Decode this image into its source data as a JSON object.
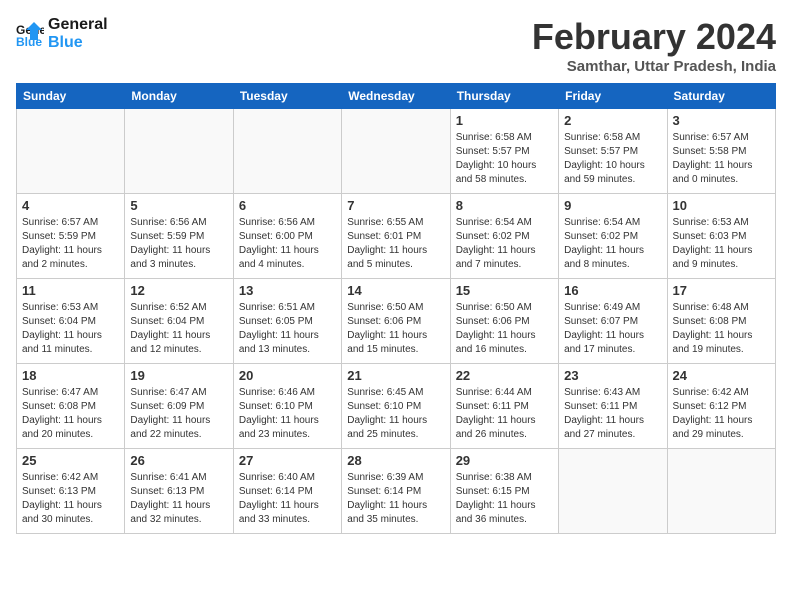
{
  "header": {
    "logo_line1": "General",
    "logo_line2": "Blue",
    "title": "February 2024",
    "subtitle": "Samthar, Uttar Pradesh, India"
  },
  "weekdays": [
    "Sunday",
    "Monday",
    "Tuesday",
    "Wednesday",
    "Thursday",
    "Friday",
    "Saturday"
  ],
  "weeks": [
    [
      {
        "num": "",
        "info": ""
      },
      {
        "num": "",
        "info": ""
      },
      {
        "num": "",
        "info": ""
      },
      {
        "num": "",
        "info": ""
      },
      {
        "num": "1",
        "info": "Sunrise: 6:58 AM\nSunset: 5:57 PM\nDaylight: 10 hours\nand 58 minutes."
      },
      {
        "num": "2",
        "info": "Sunrise: 6:58 AM\nSunset: 5:57 PM\nDaylight: 10 hours\nand 59 minutes."
      },
      {
        "num": "3",
        "info": "Sunrise: 6:57 AM\nSunset: 5:58 PM\nDaylight: 11 hours\nand 0 minutes."
      }
    ],
    [
      {
        "num": "4",
        "info": "Sunrise: 6:57 AM\nSunset: 5:59 PM\nDaylight: 11 hours\nand 2 minutes."
      },
      {
        "num": "5",
        "info": "Sunrise: 6:56 AM\nSunset: 5:59 PM\nDaylight: 11 hours\nand 3 minutes."
      },
      {
        "num": "6",
        "info": "Sunrise: 6:56 AM\nSunset: 6:00 PM\nDaylight: 11 hours\nand 4 minutes."
      },
      {
        "num": "7",
        "info": "Sunrise: 6:55 AM\nSunset: 6:01 PM\nDaylight: 11 hours\nand 5 minutes."
      },
      {
        "num": "8",
        "info": "Sunrise: 6:54 AM\nSunset: 6:02 PM\nDaylight: 11 hours\nand 7 minutes."
      },
      {
        "num": "9",
        "info": "Sunrise: 6:54 AM\nSunset: 6:02 PM\nDaylight: 11 hours\nand 8 minutes."
      },
      {
        "num": "10",
        "info": "Sunrise: 6:53 AM\nSunset: 6:03 PM\nDaylight: 11 hours\nand 9 minutes."
      }
    ],
    [
      {
        "num": "11",
        "info": "Sunrise: 6:53 AM\nSunset: 6:04 PM\nDaylight: 11 hours\nand 11 minutes."
      },
      {
        "num": "12",
        "info": "Sunrise: 6:52 AM\nSunset: 6:04 PM\nDaylight: 11 hours\nand 12 minutes."
      },
      {
        "num": "13",
        "info": "Sunrise: 6:51 AM\nSunset: 6:05 PM\nDaylight: 11 hours\nand 13 minutes."
      },
      {
        "num": "14",
        "info": "Sunrise: 6:50 AM\nSunset: 6:06 PM\nDaylight: 11 hours\nand 15 minutes."
      },
      {
        "num": "15",
        "info": "Sunrise: 6:50 AM\nSunset: 6:06 PM\nDaylight: 11 hours\nand 16 minutes."
      },
      {
        "num": "16",
        "info": "Sunrise: 6:49 AM\nSunset: 6:07 PM\nDaylight: 11 hours\nand 17 minutes."
      },
      {
        "num": "17",
        "info": "Sunrise: 6:48 AM\nSunset: 6:08 PM\nDaylight: 11 hours\nand 19 minutes."
      }
    ],
    [
      {
        "num": "18",
        "info": "Sunrise: 6:47 AM\nSunset: 6:08 PM\nDaylight: 11 hours\nand 20 minutes."
      },
      {
        "num": "19",
        "info": "Sunrise: 6:47 AM\nSunset: 6:09 PM\nDaylight: 11 hours\nand 22 minutes."
      },
      {
        "num": "20",
        "info": "Sunrise: 6:46 AM\nSunset: 6:10 PM\nDaylight: 11 hours\nand 23 minutes."
      },
      {
        "num": "21",
        "info": "Sunrise: 6:45 AM\nSunset: 6:10 PM\nDaylight: 11 hours\nand 25 minutes."
      },
      {
        "num": "22",
        "info": "Sunrise: 6:44 AM\nSunset: 6:11 PM\nDaylight: 11 hours\nand 26 minutes."
      },
      {
        "num": "23",
        "info": "Sunrise: 6:43 AM\nSunset: 6:11 PM\nDaylight: 11 hours\nand 27 minutes."
      },
      {
        "num": "24",
        "info": "Sunrise: 6:42 AM\nSunset: 6:12 PM\nDaylight: 11 hours\nand 29 minutes."
      }
    ],
    [
      {
        "num": "25",
        "info": "Sunrise: 6:42 AM\nSunset: 6:13 PM\nDaylight: 11 hours\nand 30 minutes."
      },
      {
        "num": "26",
        "info": "Sunrise: 6:41 AM\nSunset: 6:13 PM\nDaylight: 11 hours\nand 32 minutes."
      },
      {
        "num": "27",
        "info": "Sunrise: 6:40 AM\nSunset: 6:14 PM\nDaylight: 11 hours\nand 33 minutes."
      },
      {
        "num": "28",
        "info": "Sunrise: 6:39 AM\nSunset: 6:14 PM\nDaylight: 11 hours\nand 35 minutes."
      },
      {
        "num": "29",
        "info": "Sunrise: 6:38 AM\nSunset: 6:15 PM\nDaylight: 11 hours\nand 36 minutes."
      },
      {
        "num": "",
        "info": ""
      },
      {
        "num": "",
        "info": ""
      }
    ]
  ]
}
